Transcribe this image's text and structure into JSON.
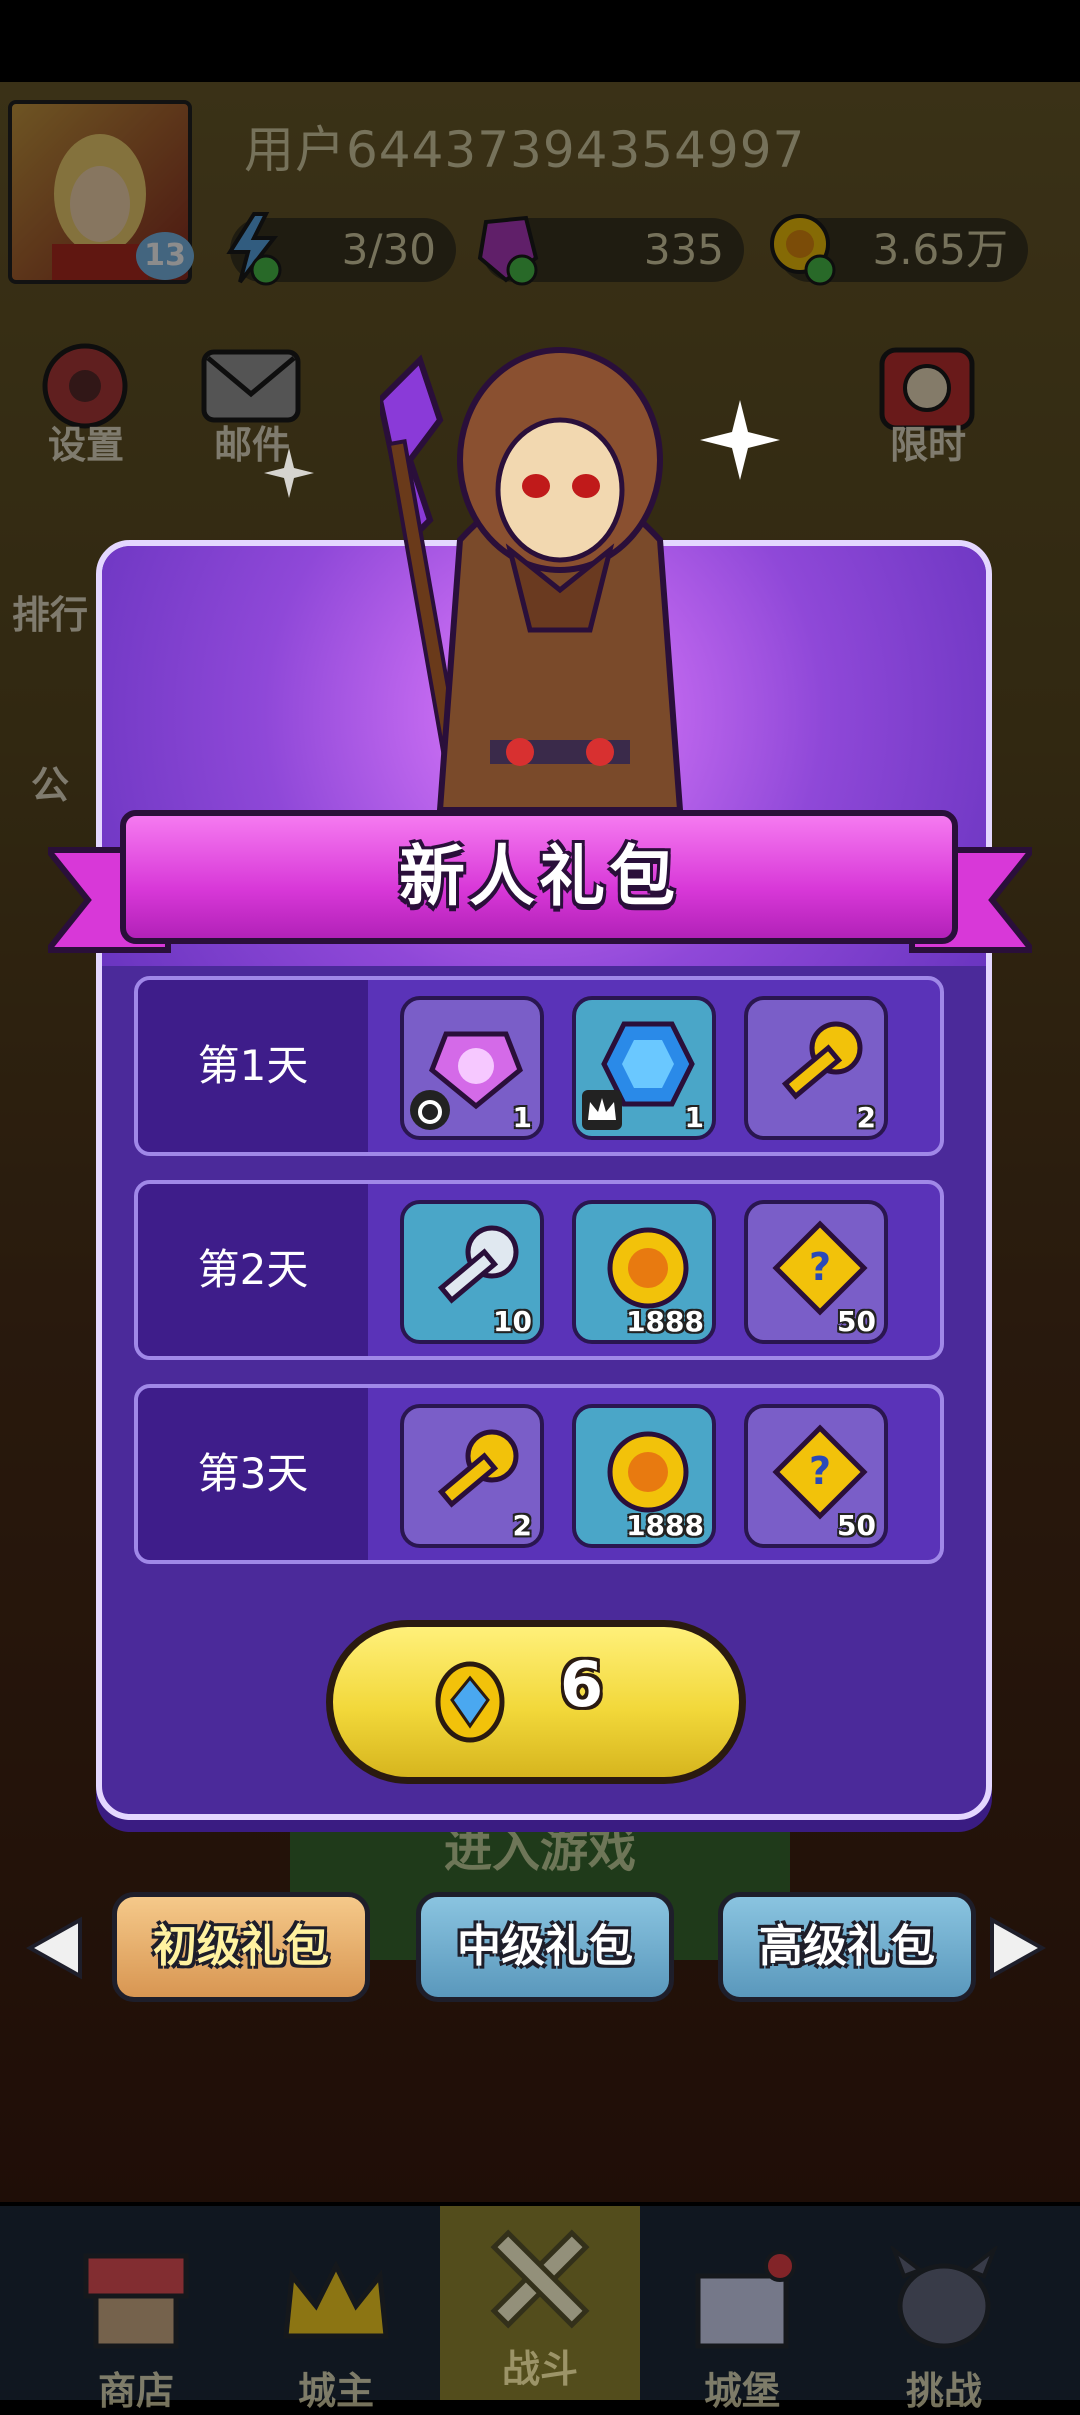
{
  "user": {
    "name": "用户64437394354997",
    "level": "13"
  },
  "resources": [
    {
      "name": "energy",
      "value": "3/30",
      "icon": "lightning-icon"
    },
    {
      "name": "gem",
      "value": "335",
      "icon": "purple-crystal-icon"
    },
    {
      "name": "gold",
      "value": "3.65万",
      "icon": "gold-coin-icon"
    }
  ],
  "menu": {
    "settings": "设置",
    "mail": "邮件",
    "limited": "限时",
    "rank_partial": "排行",
    "notice_partial": "公"
  },
  "gift": {
    "title": "新人礼包",
    "days": [
      {
        "label": "第1天",
        "items": [
          {
            "icon": "purple-gem-icon",
            "count": "1",
            "bg": "purple",
            "tag": "ring-icon"
          },
          {
            "icon": "blue-gem-icon",
            "count": "1",
            "bg": "blue",
            "tag": "crown-icon"
          },
          {
            "icon": "gold-key-icon",
            "count": "2",
            "bg": "purple",
            "tag": ""
          }
        ]
      },
      {
        "label": "第2天",
        "items": [
          {
            "icon": "silver-key-icon",
            "count": "10",
            "bg": "blue",
            "tag": ""
          },
          {
            "icon": "gold-coin-icon",
            "count": "1888",
            "bg": "blue",
            "tag": ""
          },
          {
            "icon": "mystery-puzzle-icon",
            "count": "50",
            "bg": "purple",
            "tag": ""
          }
        ]
      },
      {
        "label": "第3天",
        "items": [
          {
            "icon": "gold-key-icon",
            "count": "2",
            "bg": "purple",
            "tag": ""
          },
          {
            "icon": "gold-coin-icon",
            "count": "1888",
            "bg": "blue",
            "tag": ""
          },
          {
            "icon": "mystery-puzzle-icon",
            "count": "50",
            "bg": "purple",
            "tag": ""
          }
        ]
      }
    ],
    "price": "6",
    "price_icon": "blue-diamond-coin-icon"
  },
  "tabs": [
    {
      "label": "初级礼包",
      "active": true
    },
    {
      "label": "中级礼包",
      "active": false
    },
    {
      "label": "高级礼包",
      "active": false
    }
  ],
  "background_text": {
    "enter_game": "进入游戏"
  },
  "bottom_nav": [
    {
      "label": "商店",
      "icon": "shop-icon"
    },
    {
      "label": "城主",
      "icon": "crown-icon"
    },
    {
      "label": "战斗",
      "icon": "crossed-swords-icon"
    },
    {
      "label": "城堡",
      "icon": "castle-icon"
    },
    {
      "label": "挑战",
      "icon": "devil-icon"
    }
  ],
  "colors": {
    "panel": "#4b2a9a",
    "banner": "#d838d8",
    "buy_button": "#f2d83a",
    "tab_active": "#d89652",
    "tab_inactive": "#5a98bc"
  }
}
